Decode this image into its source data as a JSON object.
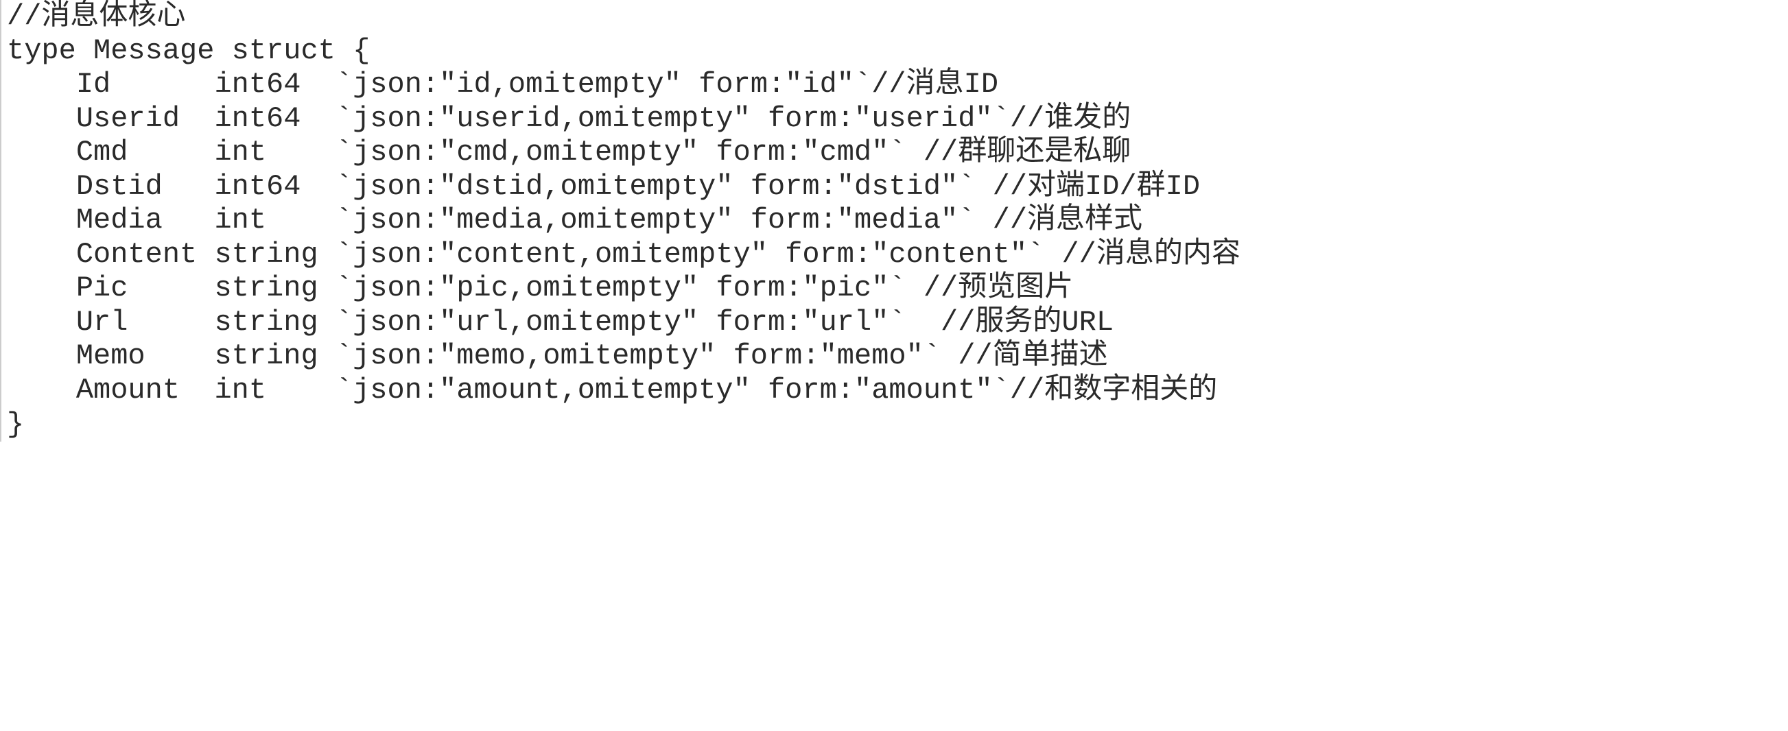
{
  "code": {
    "line1": "//消息体核心",
    "line2": "type Message struct {",
    "line3": "    Id      int64  `json:\"id,omitempty\" form:\"id\"`//消息ID",
    "line4": "    Userid  int64  `json:\"userid,omitempty\" form:\"userid\"`//谁发的",
    "line5": "    Cmd     int    `json:\"cmd,omitempty\" form:\"cmd\"` //群聊还是私聊",
    "line6": "    Dstid   int64  `json:\"dstid,omitempty\" form:\"dstid\"` //对端ID/群ID",
    "line7": "    Media   int    `json:\"media,omitempty\" form:\"media\"` //消息样式",
    "line8": "    Content string `json:\"content,omitempty\" form:\"content\"` //消息的内容",
    "line9": "    Pic     string `json:\"pic,omitempty\" form:\"pic\"` //预览图片",
    "line10": "    Url     string `json:\"url,omitempty\" form:\"url\"`  //服务的URL",
    "line11": "    Memo    string `json:\"memo,omitempty\" form:\"memo\"` //简单描述",
    "line12": "    Amount  int    `json:\"amount,omitempty\" form:\"amount\"`//和数字相关的",
    "line13": "}"
  }
}
